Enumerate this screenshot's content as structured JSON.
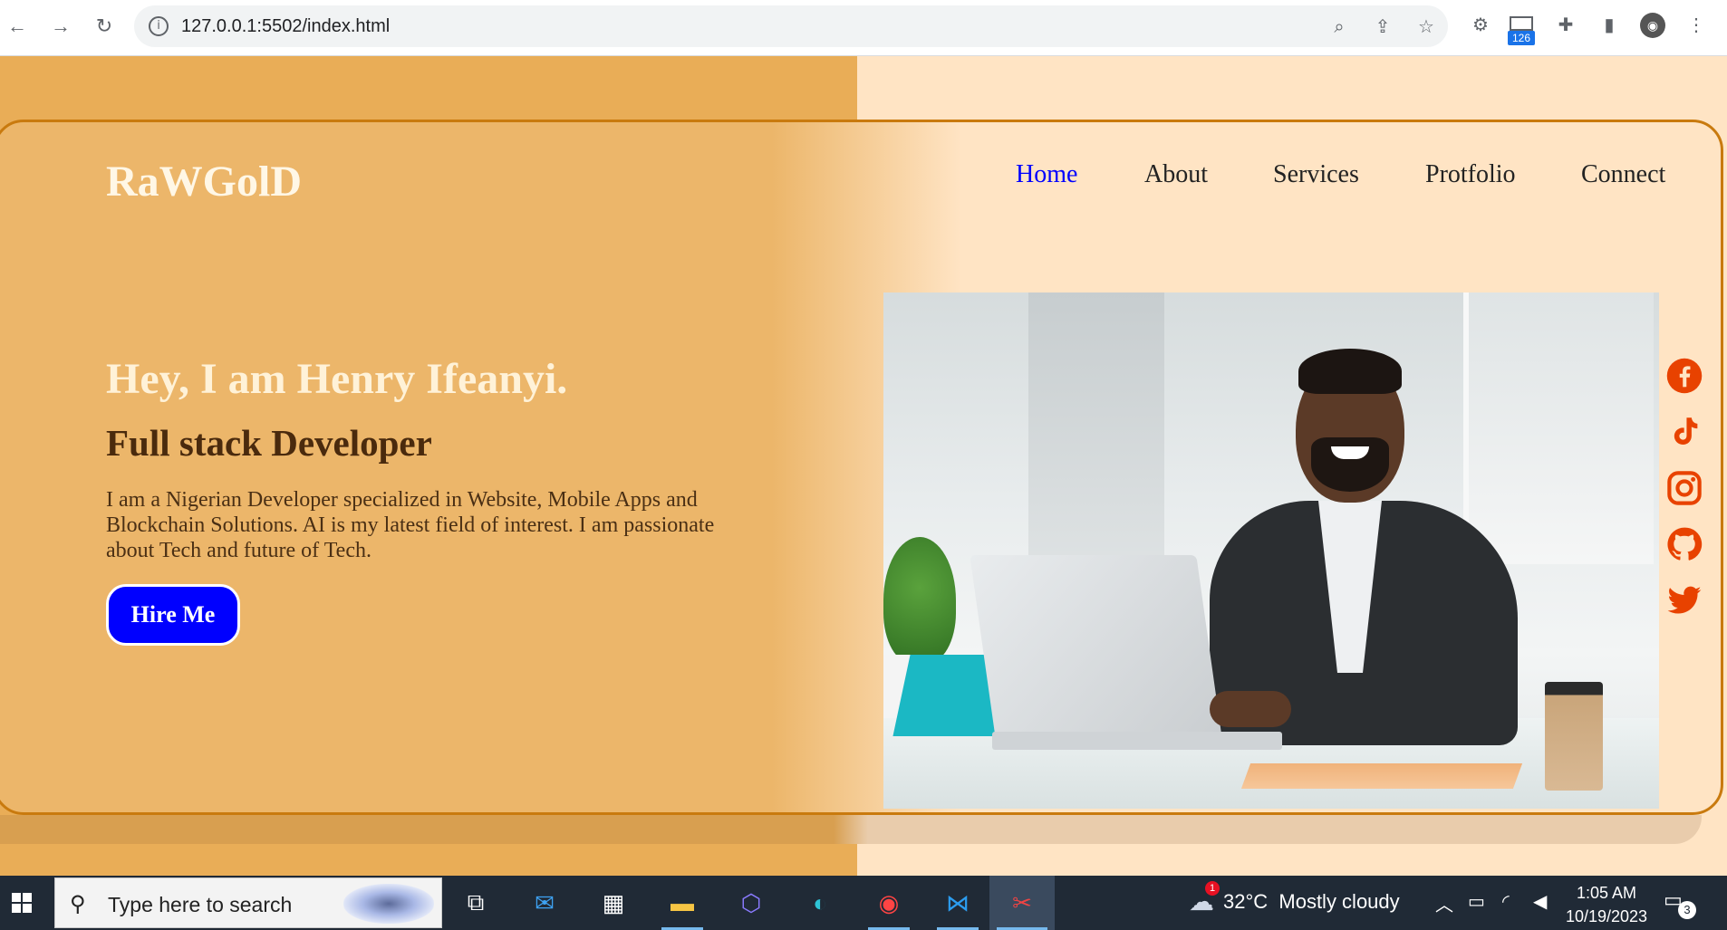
{
  "browser": {
    "url": "127.0.0.1:5502/index.html",
    "mail_badge_count": "126"
  },
  "site": {
    "logo": "RaWGolD",
    "nav": [
      {
        "label": "Home",
        "active": true
      },
      {
        "label": "About",
        "active": false
      },
      {
        "label": "Services",
        "active": false
      },
      {
        "label": "Protfolio",
        "active": false
      },
      {
        "label": "Connect",
        "active": false
      }
    ],
    "hero": {
      "title": "Hey, I am Henry Ifeanyi.",
      "subtitle": "Full stack Developer",
      "description": "I am a Nigerian Developer specialized in Website, Mobile Apps and Blockchain Solutions. AI is my latest field of interest. I am passionate about Tech and future of Tech.",
      "button": "Hire Me"
    },
    "social": [
      "facebook-icon",
      "tiktok-icon",
      "instagram-icon",
      "github-icon",
      "twitter-icon"
    ],
    "colors": {
      "accent": "#0000ff",
      "left_bg": "#e9ad57",
      "right_bg": "#ffe4c4",
      "border": "#c97a0e",
      "social": "#e84200"
    }
  },
  "taskbar": {
    "search_placeholder": "Type here to search",
    "weather": "32°C  Mostly cloudy",
    "weather_alert": "1",
    "time": "1:05 AM",
    "date": "10/19/2023",
    "notifications": "3"
  }
}
